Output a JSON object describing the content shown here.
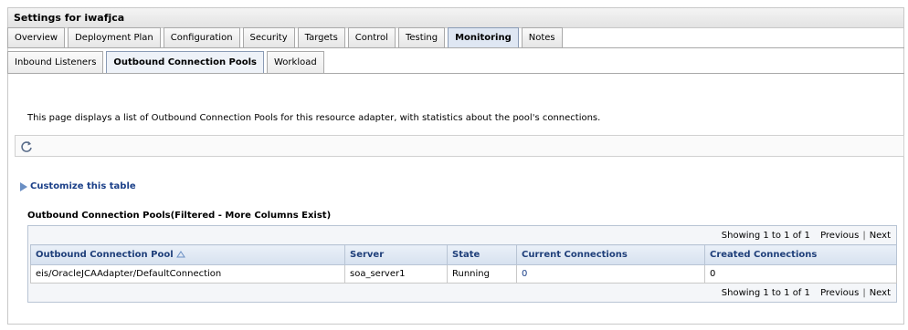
{
  "header": {
    "title": "Settings for iwafjca"
  },
  "tabs": [
    {
      "label": "Overview",
      "active": false
    },
    {
      "label": "Deployment Plan",
      "active": false
    },
    {
      "label": "Configuration",
      "active": false
    },
    {
      "label": "Security",
      "active": false
    },
    {
      "label": "Targets",
      "active": false
    },
    {
      "label": "Control",
      "active": false
    },
    {
      "label": "Testing",
      "active": false
    },
    {
      "label": "Monitoring",
      "active": true
    },
    {
      "label": "Notes",
      "active": false
    }
  ],
  "subtabs": [
    {
      "label": "Inbound Listeners",
      "active": false
    },
    {
      "label": "Outbound Connection Pools",
      "active": true
    },
    {
      "label": "Workload",
      "active": false
    }
  ],
  "description": "This page displays a list of Outbound Connection Pools for this resource adapter, with statistics about the pool's connections.",
  "toolbar": {
    "refresh_icon": "refresh-icon"
  },
  "customize_label": "Customize this table",
  "table": {
    "title": "Outbound Connection Pools(Filtered - More Columns Exist)",
    "pager": {
      "showing": "Showing 1 to 1 of 1",
      "previous": "Previous",
      "separator": "|",
      "next": "Next"
    },
    "columns": [
      "Outbound Connection Pool",
      "Server",
      "State",
      "Current Connections",
      "Created Connections"
    ],
    "rows": [
      [
        "eis/OracleJCAAdapter/DefaultConnection",
        "soa_server1",
        "Running",
        "0",
        "0"
      ]
    ]
  },
  "colors": {
    "accent": "#1a3f88",
    "header_bg": "#d6e1ef",
    "link": "#1a3f88"
  }
}
